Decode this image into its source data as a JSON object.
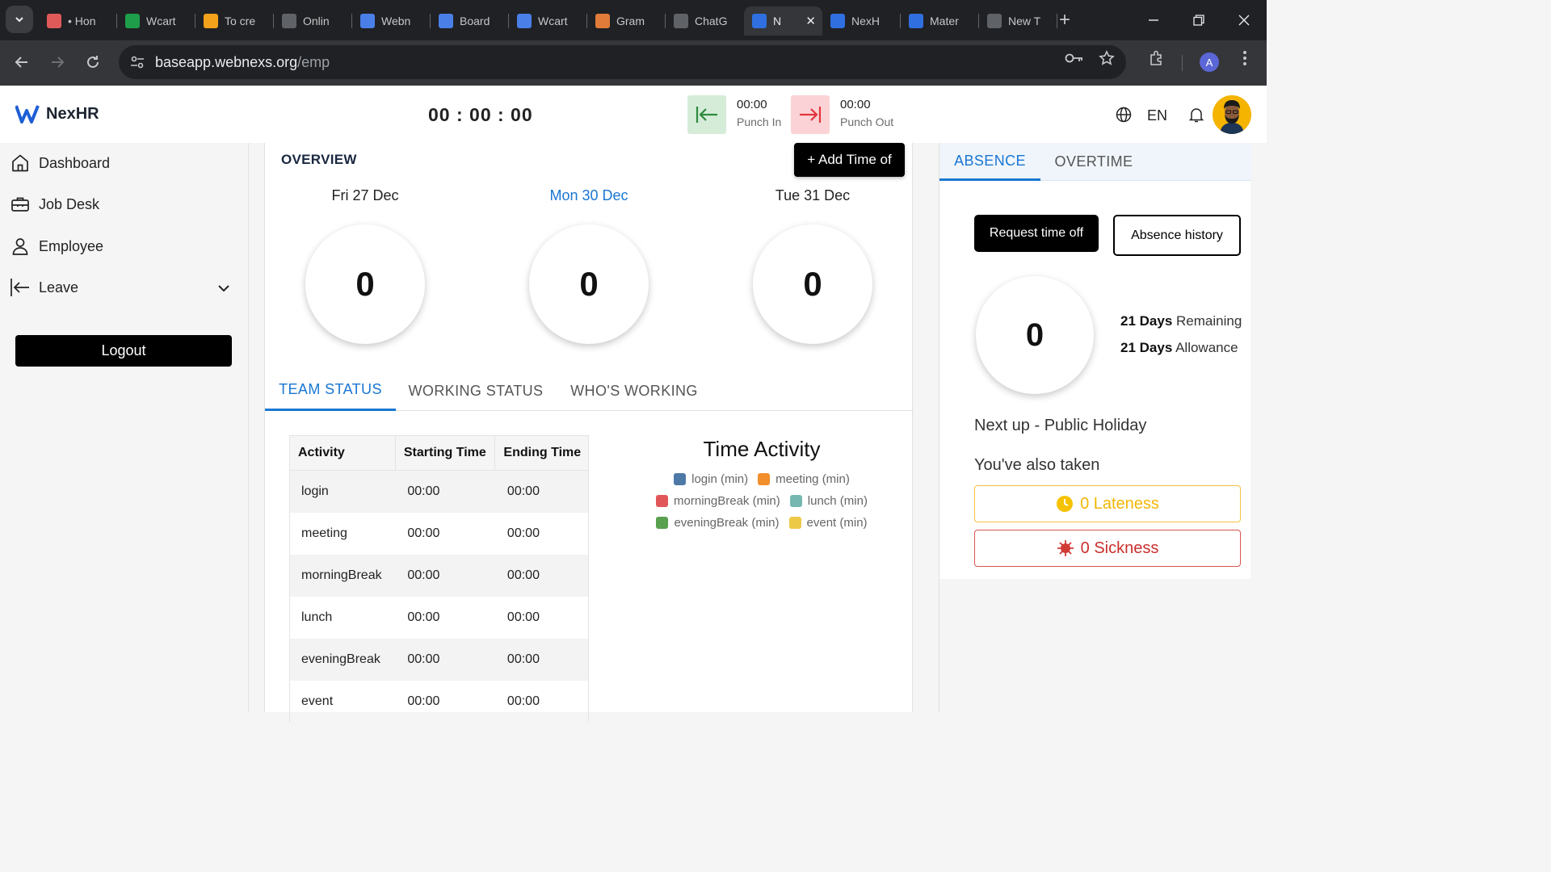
{
  "browser": {
    "tabs": [
      {
        "title": "• Hon",
        "color": "#e05a5a"
      },
      {
        "title": "Wcart",
        "color": "#1e9e4a"
      },
      {
        "title": "To cre",
        "color": "#f3a21b"
      },
      {
        "title": "Onlin",
        "color": "#5f6368"
      },
      {
        "title": "Webn",
        "color": "#4a7fe8"
      },
      {
        "title": "Board",
        "color": "#4a7fe8"
      },
      {
        "title": "Wcart",
        "color": "#4a7fe8"
      },
      {
        "title": "Gram",
        "color": "#e07b39"
      },
      {
        "title": "ChatG",
        "color": "#5f6368"
      },
      {
        "title": "N",
        "color": "#2f6fe0",
        "active": true
      },
      {
        "title": "NexH",
        "color": "#2f6fe0"
      },
      {
        "title": "Mater",
        "color": "#2f6fe0"
      },
      {
        "title": "New T",
        "color": "#5f6368"
      }
    ],
    "url_host": "baseapp.webnexs.org",
    "url_path": "/emp",
    "profile_initial": "A"
  },
  "header": {
    "logo_text": "NexHR",
    "clock": "00 : 00 : 00",
    "punch_in_time": "00:00",
    "punch_in_label": "Punch In",
    "punch_out_time": "00:00",
    "punch_out_label": "Punch Out",
    "language": "EN"
  },
  "sidebar": {
    "items": [
      {
        "label": "Dashboard",
        "icon": "home-icon"
      },
      {
        "label": "Job Desk",
        "icon": "briefcase-icon"
      },
      {
        "label": "Employee",
        "icon": "person-icon"
      },
      {
        "label": "Leave",
        "icon": "leave-icon"
      }
    ],
    "logout_label": "Logout"
  },
  "overview": {
    "title": "OVERVIEW",
    "add_time_label": "+ Add Time of",
    "days": [
      {
        "label": "Fri 27 Dec",
        "value": "0"
      },
      {
        "label": "Mon 30 Dec",
        "value": "0",
        "today": true
      },
      {
        "label": "Tue 31 Dec",
        "value": "0"
      }
    ],
    "tabs": [
      "TEAM STATUS",
      "WORKING STATUS",
      "WHO'S WORKING"
    ],
    "table": {
      "headers": [
        "Activity",
        "Starting Time",
        "Ending Time"
      ],
      "rows": [
        [
          "login",
          "00:00",
          "00:00"
        ],
        [
          "meeting",
          "00:00",
          "00:00"
        ],
        [
          "morningBreak",
          "00:00",
          "00:00"
        ],
        [
          "lunch",
          "00:00",
          "00:00"
        ],
        [
          "eveningBreak",
          "00:00",
          "00:00"
        ],
        [
          "event",
          "00:00",
          "00:00"
        ]
      ]
    },
    "chart": {
      "title": "Time Activity",
      "legend": [
        {
          "label": "login (min)",
          "color": "#4e79a7"
        },
        {
          "label": "meeting (min)",
          "color": "#f28e2b"
        },
        {
          "label": "morningBreak (min)",
          "color": "#e15759"
        },
        {
          "label": "lunch (min)",
          "color": "#76b7b2"
        },
        {
          "label": "eveningBreak (min)",
          "color": "#59a14f"
        },
        {
          "label": "event (min)",
          "color": "#edc948"
        }
      ]
    }
  },
  "absence": {
    "tabs": [
      "ABSENCE",
      "OVERTIME"
    ],
    "request_label": "Request time off",
    "history_label": "Absence history",
    "value": "0",
    "remaining_num": "21 Days",
    "remaining_text": "Remaining",
    "allowance_num": "21 Days",
    "allowance_text": "Allowance",
    "next_up": "Next up - Public Holiday",
    "also_taken": "You've also taken",
    "lateness": "0 Lateness",
    "sickness": "0 Sickness"
  }
}
